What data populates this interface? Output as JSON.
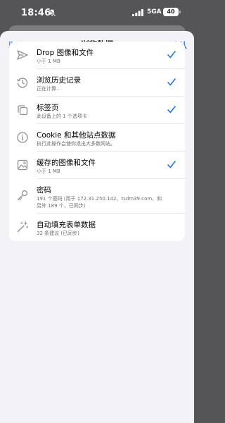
{
  "status_bar": {
    "time": "18:46",
    "network": "5GA",
    "battery": "40"
  },
  "nav": {
    "cancel": "取消",
    "title": "浏览数据",
    "confirm": "确认"
  },
  "items": [
    {
      "title": "Drop 图像和文件",
      "subtitle": "小于 1 MB",
      "checked": true,
      "icon": "send-icon"
    },
    {
      "title": "浏览历史记录",
      "subtitle": "正在计算...",
      "checked": true,
      "icon": "history-icon"
    },
    {
      "title": "标签页",
      "subtitle": "此设备上的 1 个选项卡",
      "checked": true,
      "icon": "tabs-icon"
    },
    {
      "title": "Cookie 和其他站点数据",
      "subtitle": "执行此操作会使你退出大多数网站。",
      "checked": false,
      "icon": "info-icon"
    },
    {
      "title": "缓存的图像和文件",
      "subtitle": "小于 1 MB",
      "checked": true,
      "icon": "image-icon"
    },
    {
      "title": "密码",
      "subtitle": "191 个密码 (用于 172.31.250.142、tsdm39.com、和",
      "subtitle2": "另外 189 个，已同步)",
      "checked": false,
      "icon": "key-icon"
    },
    {
      "title": "自动填充表单数据",
      "subtitle": "32 条建议 (已同步)",
      "checked": false,
      "icon": "magic-wand-icon"
    }
  ],
  "colors": {
    "accent": "#1a73e8",
    "icon_gray": "#8e8e93",
    "sheet_bg": "#f2f2f7"
  }
}
